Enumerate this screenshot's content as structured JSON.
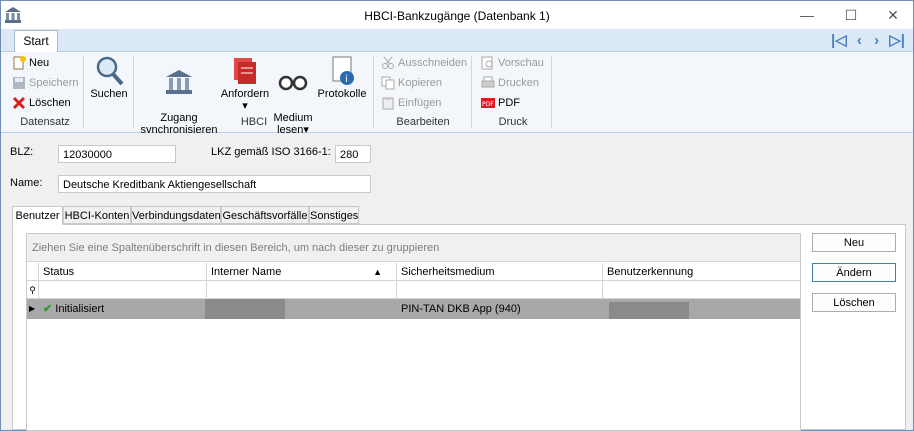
{
  "window": {
    "title": "HBCI-Bankzugänge (Datenbank 1)",
    "minimize": "—",
    "maximize": "☐",
    "close": "✕"
  },
  "ribbon_tab": "Start",
  "nav": {
    "first": "|◁",
    "prev": "‹",
    "next": "›",
    "last": "▷|"
  },
  "groups": {
    "datensatz": {
      "label": "Datensatz",
      "neu": "Neu",
      "speichern": "Speichern",
      "loeschen": "Löschen"
    },
    "suchen": {
      "label": "Suchen"
    },
    "hbci": {
      "label": "HBCI",
      "zugang": "Zugang\nsynchronisieren",
      "anfordern": "Anfordern",
      "medium": "Medium\nlesen",
      "protokolle": "Protokolle"
    },
    "bearbeiten": {
      "label": "Bearbeiten",
      "ausschneiden": "Ausschneiden",
      "kopieren": "Kopieren",
      "einfuegen": "Einfügen"
    },
    "druck": {
      "label": "Druck",
      "vorschau": "Vorschau",
      "drucken": "Drucken",
      "pdf": "PDF"
    }
  },
  "form": {
    "blz_label": "BLZ:",
    "blz_value": "12030000",
    "lkz_label": "LKZ gemäß ISO 3166-1:",
    "lkz_value": "280",
    "name_label": "Name:",
    "name_value": "Deutsche Kreditbank Aktiengesellschaft"
  },
  "tabs": [
    "Benutzer",
    "HBCI-Konten",
    "Verbindungsdaten",
    "Geschäftsvorfälle",
    "Sonstiges"
  ],
  "grid": {
    "group_hint": "Ziehen Sie eine Spaltenüberschrift in diesen Bereich, um nach dieser zu gruppieren",
    "columns": [
      "Status",
      "Interner Name",
      "Sicherheitsmedium",
      "Benutzerkennung"
    ],
    "rows": [
      {
        "status": "Initialisiert",
        "interner_name": "",
        "sicherheitsmedium": "PIN-TAN DKB App (940)",
        "benutzerkennung": ""
      }
    ]
  },
  "side_buttons": {
    "neu": "Neu",
    "aendern": "Ändern",
    "loeschen": "Löschen"
  },
  "colors": {
    "accent": "#4a7fc1",
    "ribbon_bg": "#f3f7fb",
    "selected_row": "#a8a8a8"
  }
}
